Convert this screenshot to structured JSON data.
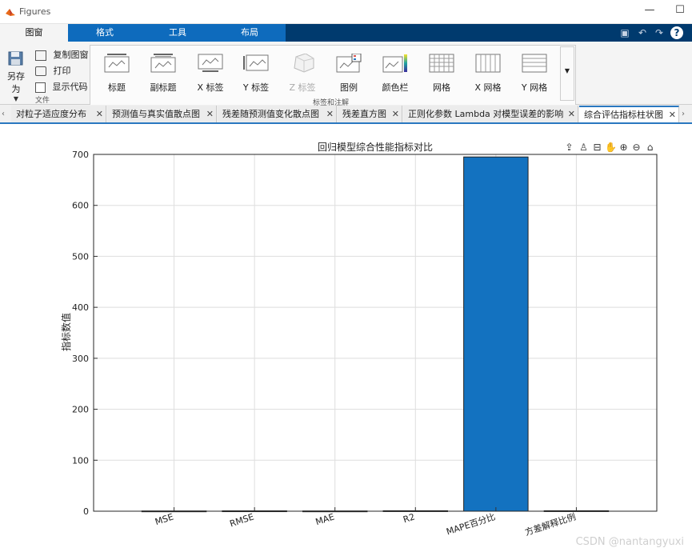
{
  "window": {
    "title": "Figures"
  },
  "ribbon": {
    "tabs": [
      "图窗",
      "格式",
      "工具",
      "布局"
    ],
    "active_tab": "图窗",
    "file_group": {
      "save_as": "另存为",
      "copy_figure": "复制图窗",
      "print": "打印",
      "show_code": "显示代码",
      "label": "文件"
    },
    "annotation_group": {
      "buttons": [
        "标题",
        "副标题",
        "X 标签",
        "Y 标签",
        "Z 标签",
        "图例",
        "颜色栏",
        "网格",
        "X 网格",
        "Y 网格"
      ],
      "label": "标签和注解"
    }
  },
  "document_tabs": {
    "items": [
      "对粒子适应度分布",
      "预测值与真实值散点图",
      "残差随预测值变化散点图",
      "残差直方图",
      "正则化参数 Lambda 对模型误差的影响",
      "综合评估指标柱状图"
    ],
    "active_index": 5
  },
  "chart_data": {
    "type": "bar",
    "title": "回归模型综合性能指标对比",
    "xlabel": "",
    "ylabel": "指标数值",
    "categories": [
      "MSE",
      "RMSE",
      "MAE",
      "R2",
      "MAPE百分比",
      "方差解释比例"
    ],
    "values": [
      0.5,
      0.7,
      0.5,
      0.9,
      695,
      0.9
    ],
    "ylim": [
      0,
      700
    ],
    "yticks": [
      0,
      100,
      200,
      300,
      400,
      500,
      600,
      700
    ],
    "bar_color": "#1372c0",
    "grid": true
  },
  "watermark": "CSDN @nantangyuxi"
}
